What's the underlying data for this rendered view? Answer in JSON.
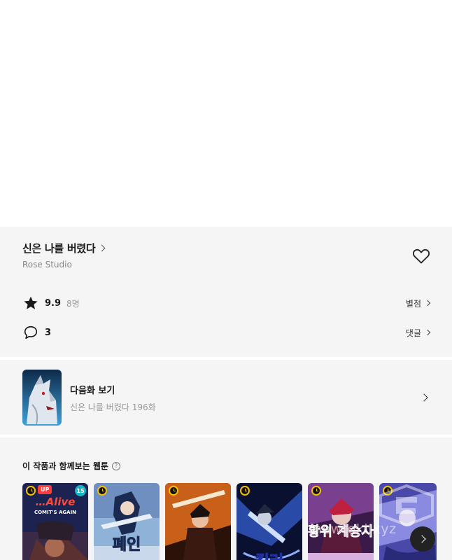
{
  "work": {
    "title": "신은 나를 버렸다",
    "author": "Rose Studio",
    "rating": "9.9",
    "rating_count": "8명",
    "rating_link": "별점",
    "comment_count": "3",
    "comment_link": "댓글"
  },
  "next_episode": {
    "label": "다음화 보기",
    "subtitle": "신은 나를 버렸다 196화"
  },
  "recommendations": {
    "heading": "이 작품과 함께보는 웹툰",
    "help_icon": "?",
    "cards": [
      {
        "cover_text": "…Alive",
        "cover_subtext": "COMIT'S AGAIN",
        "badge_up": "UP",
        "badge_age": "15"
      },
      {
        "cover_text": "폐인"
      },
      {
        "cover_text": ""
      },
      {
        "cover_text": "킬러"
      },
      {
        "cover_text": "황위 계승자"
      },
      {
        "cover_text": ""
      }
    ]
  },
  "watermark": "newtoki.xyz",
  "icons": {
    "title_chevron": "chevron-right-icon",
    "favorite": "heart-icon",
    "rating": "star-icon",
    "comment": "comment-icon",
    "carousel_next": "chevron-right-icon",
    "schedule_badge": "clock-icon"
  },
  "colors": {
    "section_bg": "#f5f5f5",
    "up_badge": "#ff3b3b",
    "age_badge": "#13b6c4",
    "clock_badge": "#f5c000"
  }
}
